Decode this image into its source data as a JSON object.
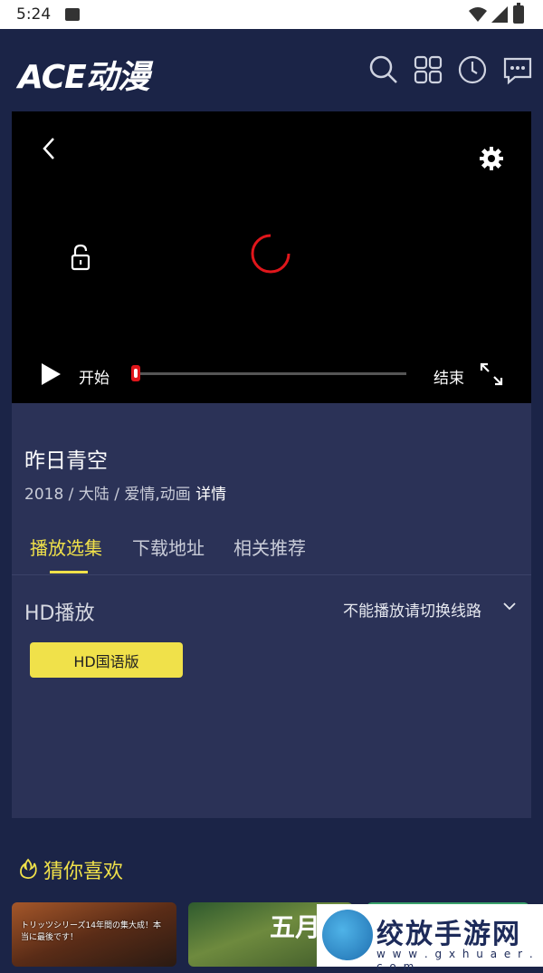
{
  "status_bar": {
    "time": "5:24"
  },
  "app": {
    "logo_text": "ACE动漫"
  },
  "player": {
    "start_label": "开始",
    "end_label": "结束",
    "progress": 0.0
  },
  "video": {
    "title": "昨日青空",
    "meta": "2018 / 大陆 / 爱情,动画",
    "details_link": "详情"
  },
  "tabs": [
    {
      "label": "播放选集",
      "active": true
    },
    {
      "label": "下载地址",
      "active": false
    },
    {
      "label": "相关推荐",
      "active": false
    }
  ],
  "episodes": {
    "section_title": "HD播放",
    "switch_route": "不能播放请切换线路",
    "buttons": [
      "HD国语版"
    ]
  },
  "recommend": {
    "title": "猜你喜欢",
    "card1_banner": "トリッツシリーズ14年間の集大成！本当に最後です！",
    "card2_glyph": "五月"
  },
  "watermark": {
    "text": "绞放手游网",
    "url": "w w w . g x h u a e r . c o m"
  },
  "colors": {
    "accent": "#f0e14a",
    "background": "#1b2447",
    "panel": "#2b3257",
    "progress_thumb": "#e0161b"
  }
}
